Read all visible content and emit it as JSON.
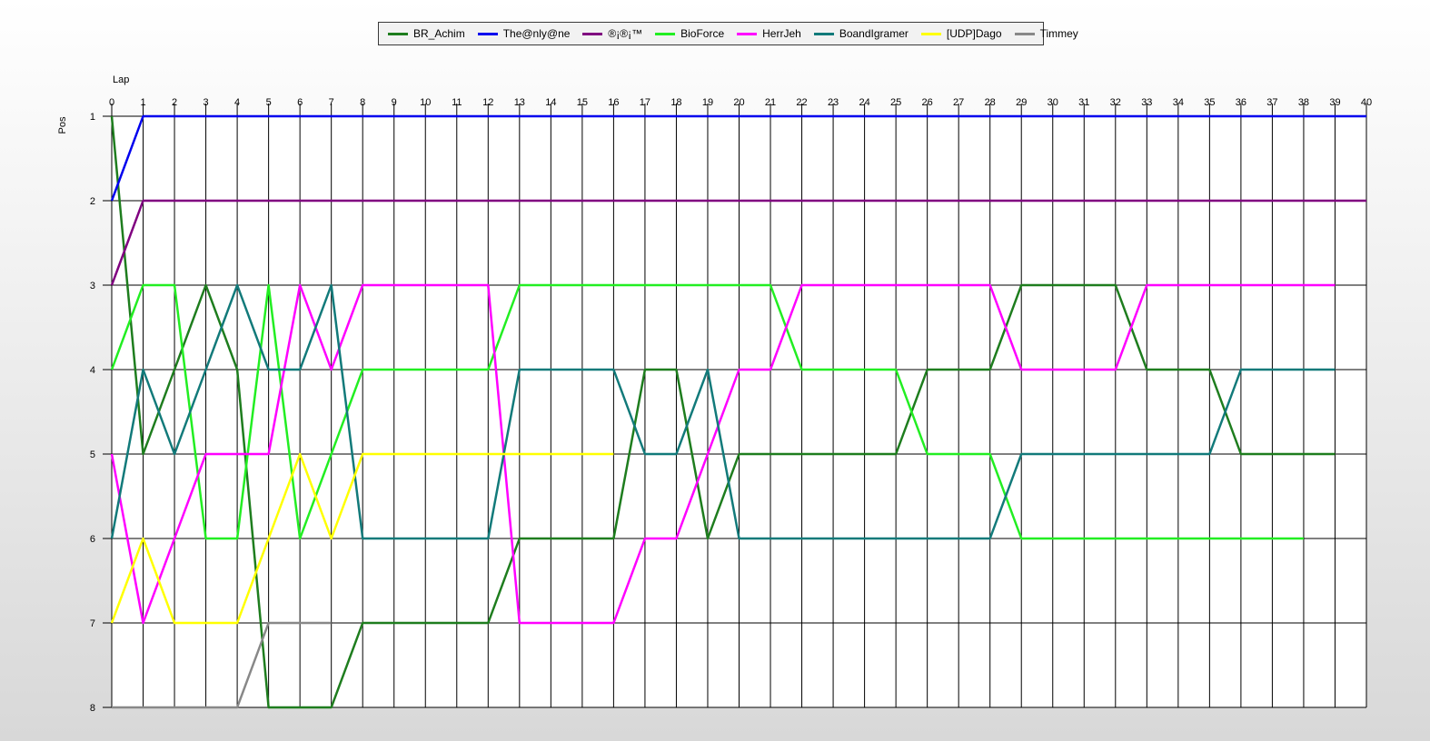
{
  "chart_data": {
    "type": "line",
    "xlabel": "Lap",
    "ylabel": "Pos",
    "xlim": [
      0,
      40
    ],
    "ylim": [
      1,
      8
    ],
    "y_inverted": true,
    "grid": true,
    "legend_position": "top-center",
    "x_ticks": [
      0,
      1,
      2,
      3,
      4,
      5,
      6,
      7,
      8,
      9,
      10,
      11,
      12,
      13,
      14,
      15,
      16,
      17,
      18,
      19,
      20,
      21,
      22,
      23,
      24,
      25,
      26,
      27,
      28,
      29,
      30,
      31,
      32,
      33,
      34,
      35,
      36,
      37,
      38,
      39,
      40
    ],
    "y_ticks": [
      1,
      2,
      3,
      4,
      5,
      6,
      7,
      8
    ],
    "series": [
      {
        "name": "BR_Achim",
        "color": "#1e7d1e",
        "values": [
          1,
          5,
          4,
          3,
          4,
          8,
          8,
          8,
          7,
          7,
          7,
          7,
          7,
          6,
          6,
          6,
          6,
          4,
          4,
          6,
          5,
          5,
          5,
          5,
          5,
          5,
          4,
          4,
          4,
          3,
          3,
          3,
          3,
          4,
          4,
          4,
          5,
          5,
          5,
          5
        ]
      },
      {
        "name": "The@nly@ne",
        "color": "#0000ee",
        "values": [
          2,
          1,
          1,
          1,
          1,
          1,
          1,
          1,
          1,
          1,
          1,
          1,
          1,
          1,
          1,
          1,
          1,
          1,
          1,
          1,
          1,
          1,
          1,
          1,
          1,
          1,
          1,
          1,
          1,
          1,
          1,
          1,
          1,
          1,
          1,
          1,
          1,
          1,
          1,
          1,
          1
        ]
      },
      {
        "name": "®¡®¡™",
        "color": "#800080",
        "values": [
          3,
          2,
          2,
          2,
          2,
          2,
          2,
          2,
          2,
          2,
          2,
          2,
          2,
          2,
          2,
          2,
          2,
          2,
          2,
          2,
          2,
          2,
          2,
          2,
          2,
          2,
          2,
          2,
          2,
          2,
          2,
          2,
          2,
          2,
          2,
          2,
          2,
          2,
          2,
          2,
          2
        ]
      },
      {
        "name": "BioForce",
        "color": "#22ee22",
        "values": [
          4,
          3,
          3,
          6,
          6,
          3,
          6,
          5,
          4,
          4,
          4,
          4,
          4,
          3,
          3,
          3,
          3,
          3,
          3,
          3,
          3,
          3,
          4,
          4,
          4,
          4,
          5,
          5,
          5,
          6,
          6,
          6,
          6,
          6,
          6,
          6,
          6,
          6,
          6
        ]
      },
      {
        "name": "HerrJeh",
        "color": "#ff00ff",
        "values": [
          5,
          7,
          6,
          5,
          5,
          5,
          3,
          4,
          3,
          3,
          3,
          3,
          3,
          7,
          7,
          7,
          7,
          6,
          6,
          5,
          4,
          4,
          3,
          3,
          3,
          3,
          3,
          3,
          3,
          4,
          4,
          4,
          4,
          3,
          3,
          3,
          3,
          3,
          3,
          3
        ]
      },
      {
        "name": "BoandIgramer",
        "color": "#127a7a",
        "values": [
          6,
          4,
          5,
          4,
          3,
          4,
          4,
          3,
          6,
          6,
          6,
          6,
          6,
          4,
          4,
          4,
          4,
          5,
          5,
          4,
          6,
          6,
          6,
          6,
          6,
          6,
          6,
          6,
          6,
          5,
          5,
          5,
          5,
          5,
          5,
          5,
          4,
          4,
          4,
          4
        ]
      },
      {
        "name": "[UDP]Dago",
        "color": "#ffff00",
        "values": [
          7,
          6,
          7,
          7,
          7,
          6,
          5,
          6,
          5,
          5,
          5,
          5,
          5,
          5,
          5,
          5,
          5
        ]
      },
      {
        "name": "Timmey",
        "color": "#888888",
        "values": [
          8,
          8,
          8,
          8,
          8,
          7,
          7,
          7
        ]
      }
    ]
  }
}
